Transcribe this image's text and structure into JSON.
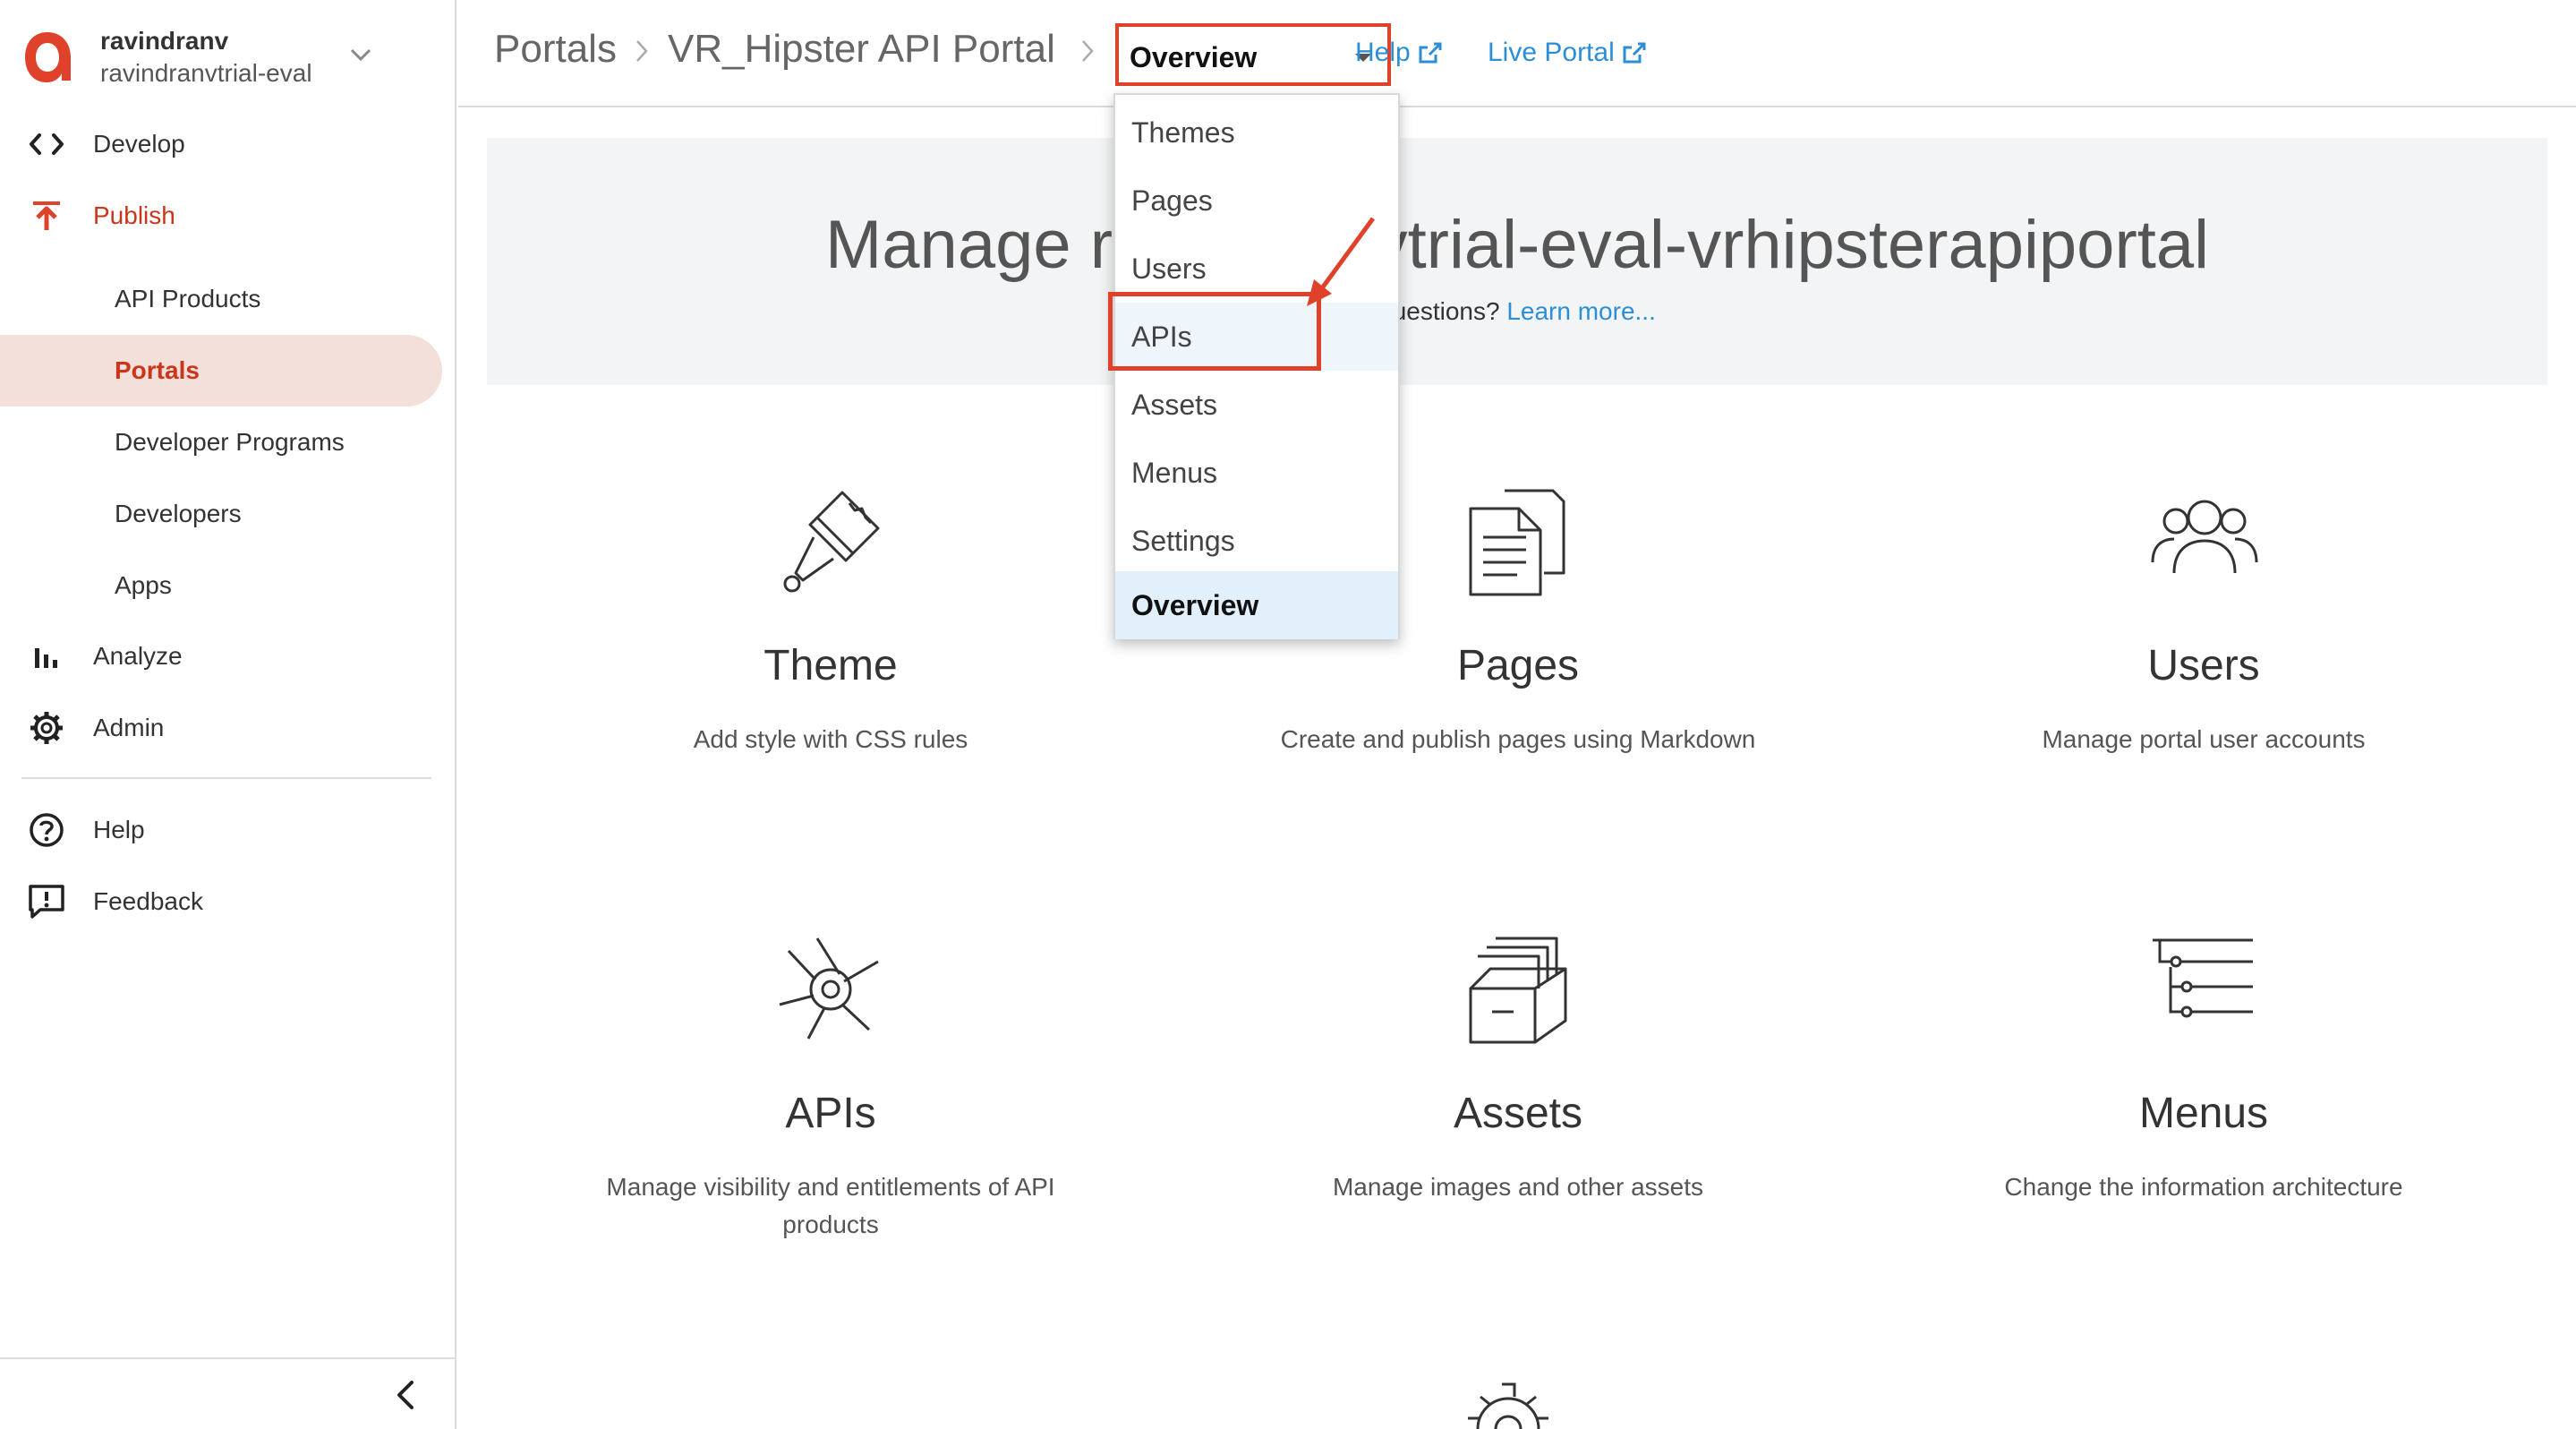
{
  "org": {
    "name": "ravindranv",
    "sub": "ravindranvtrial-eval"
  },
  "nav": {
    "develop": "Develop",
    "publish": "Publish",
    "publish_items": [
      "API Products",
      "Portals",
      "Developer Programs",
      "Developers",
      "Apps"
    ],
    "analyze": "Analyze",
    "admin": "Admin",
    "help": "Help",
    "feedback": "Feedback"
  },
  "breadcrumb": {
    "root": "Portals",
    "portal": "VR_Hipster API Portal"
  },
  "page_select": {
    "value": "Overview",
    "options": [
      "Themes",
      "Pages",
      "Users",
      "APIs",
      "Assets",
      "Menus",
      "Settings",
      "Overview"
    ]
  },
  "header_links": {
    "help": "Help",
    "live_portal": "Live Portal"
  },
  "banner": {
    "title": "Manage ravindranvtrial-eval-vrhipsterapiportal",
    "sub_prefix": "questions?",
    "learn_more": "Learn more..."
  },
  "tiles": [
    {
      "title": "Theme",
      "desc": "Add style with CSS rules"
    },
    {
      "title": "Pages",
      "desc": "Create and publish pages using Markdown"
    },
    {
      "title": "Users",
      "desc": "Manage portal user accounts"
    },
    {
      "title": "APIs",
      "desc": "Manage visibility and entitlements of API products"
    },
    {
      "title": "Assets",
      "desc": "Manage images and other assets"
    },
    {
      "title": "Menus",
      "desc": "Change the information architecture"
    }
  ],
  "colors": {
    "accent": "#c9361b",
    "link": "#2c8ed6",
    "annotation": "#e0412a",
    "selected_bg": "#f3e0da"
  }
}
